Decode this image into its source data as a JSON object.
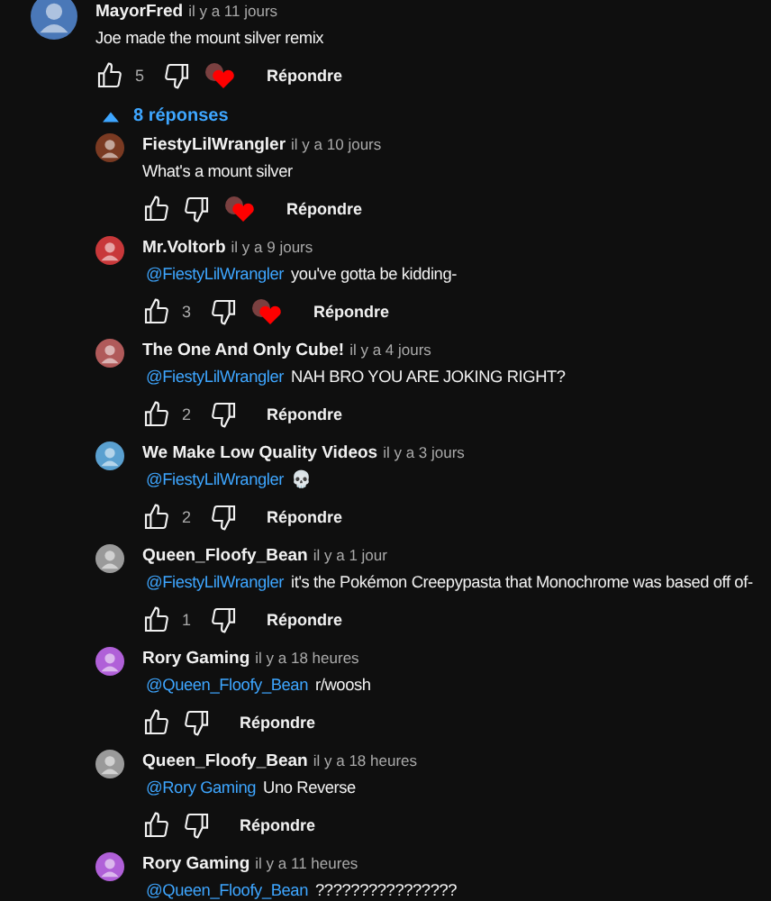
{
  "comment": {
    "author": "MayorFred",
    "time": "il y a 11 jours",
    "text": "Joe made the mount silver remix",
    "likes": "5",
    "hearted": true,
    "color": "#4a78b8",
    "reply_label": "Répondre"
  },
  "replies_toggle": {
    "label": "8 réponses",
    "expanded": true
  },
  "replies": [
    {
      "author": "FiestyLilWrangler",
      "time": "il y a 10 jours",
      "text": "What's a mount silver",
      "hearted": true,
      "color": "#7a3a22",
      "reply_label": "Répondre"
    },
    {
      "author": "Mr.Voltorb",
      "time": "il y a 9 jours",
      "mention": "@FiestyLilWrangler",
      "text": "you've gotta be kidding-",
      "likes": "3",
      "hearted": true,
      "color": "#c8383a",
      "reply_label": "Répondre"
    },
    {
      "author": "The One And Only Cube!",
      "time": "il y a 4 jours",
      "mention": "@FiestyLilWrangler",
      "text": "NAH BRO YOU ARE JOKING RIGHT?",
      "likes": "2",
      "hearted": false,
      "color": "#b05a5a",
      "reply_label": "Répondre"
    },
    {
      "author": "We Make Low Quality Videos",
      "time": "il y a 3 jours",
      "mention": "@FiestyLilWrangler",
      "text": "💀",
      "likes": "2",
      "hearted": false,
      "color": "#5aa0d0",
      "reply_label": "Répondre"
    },
    {
      "author": "Queen_Floofy_Bean",
      "time": "il y a 1 jour",
      "mention": "@FiestyLilWrangler",
      "text": "it's the Pokémon Creepypasta that Monochrome was based off of-",
      "likes": "1",
      "hearted": false,
      "color": "#9a9a9a",
      "reply_label": "Répondre"
    },
    {
      "author": "Rory Gaming",
      "time": "il y a 18 heures",
      "mention": "@Queen_Floofy_Bean",
      "text": "r/woosh",
      "hearted": false,
      "color": "#b060d8",
      "reply_label": "Répondre"
    },
    {
      "author": "Queen_Floofy_Bean",
      "time": "il y a 18 heures",
      "mention": "@Rory Gaming",
      "text": "Uno Reverse",
      "hearted": false,
      "color": "#9a9a9a",
      "reply_label": "Répondre"
    },
    {
      "author": "Rory Gaming",
      "time": "il y a 11 heures",
      "mention": "@Queen_Floofy_Bean",
      "text": "????????????????",
      "color": "#b060d8"
    }
  ]
}
